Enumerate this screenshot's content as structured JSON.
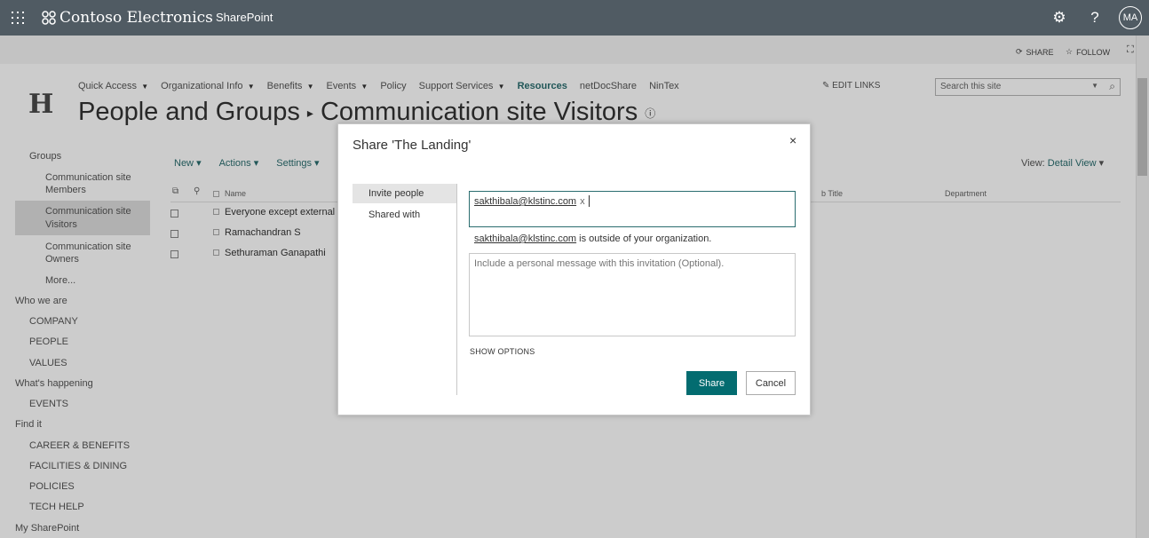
{
  "suitebar": {
    "brand": "Contoso Electronics",
    "app": "SharePoint",
    "avatar_initials": "MA",
    "icons": [
      "waffle-icon",
      "gear-icon",
      "help-icon"
    ]
  },
  "promo": {
    "share": "SHARE",
    "follow": "FOLLOW"
  },
  "logo": "H",
  "topnav": [
    {
      "label": "Quick Access",
      "caret": true
    },
    {
      "label": "Organizational Info",
      "caret": true
    },
    {
      "label": "Benefits",
      "caret": true
    },
    {
      "label": "Events",
      "caret": true
    },
    {
      "label": "Policy",
      "caret": false
    },
    {
      "label": "Support Services",
      "caret": true
    },
    {
      "label": "Resources",
      "caret": false
    },
    {
      "label": "netDocShare",
      "caret": false
    },
    {
      "label": "NinTex",
      "caret": false
    }
  ],
  "edit_links": "EDIT LINKS",
  "search": {
    "placeholder": "Search this site"
  },
  "breadcrumb": {
    "part1": "People and Groups",
    "part2": "Communication site Visitors"
  },
  "leftnav": {
    "groups": "Groups",
    "members_1": "Communication site",
    "members_2": "Members",
    "visitors_1": "Communication site",
    "visitors_2": "Visitors",
    "owners_1": "Communication site",
    "owners_2": "Owners",
    "more": "More...",
    "who": "Who we are",
    "company": "COMPANY",
    "people": "PEOPLE",
    "values": "VALUES",
    "happening": "What's happening",
    "events": "EVENTS",
    "find": "Find it",
    "career": "CAREER & BENEFITS",
    "facilities": "FACILITIES & DINING",
    "policies": "POLICIES",
    "techhelp": "TECH HELP",
    "mysp": "My SharePoint"
  },
  "cmdbar": {
    "new": "New",
    "actions": "Actions",
    "settings": "Settings"
  },
  "view": {
    "label": "View:",
    "value": "Detail View"
  },
  "table": {
    "col_name": "Name",
    "col_title": "b Title",
    "col_dept": "Department",
    "rows": [
      "Everyone except external u",
      "Ramachandran S",
      "Sethuraman Ganapathi"
    ]
  },
  "dialog": {
    "title": "Share 'The Landing'",
    "close": "×",
    "tab_invite": "Invite people",
    "tab_shared": "Shared with",
    "recipient": "sakthibala@klstinc.com",
    "remove": "x",
    "warning_email": "sakthibala@klstinc.com",
    "warning_text": " is outside of your organization.",
    "message_placeholder": "Include a personal message with this invitation (Optional).",
    "show_options": "SHOW OPTIONS",
    "share": "Share",
    "cancel": "Cancel"
  }
}
